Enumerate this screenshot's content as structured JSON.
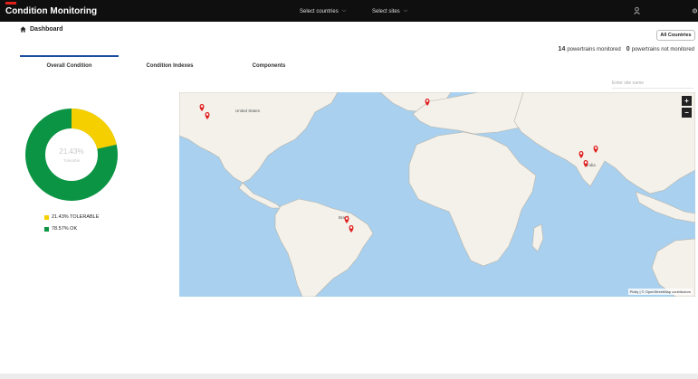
{
  "app": {
    "title": "Condition Monitoring",
    "brand_color": "#e0211b",
    "select_countries": "Select countries",
    "select_sites": "Select sites",
    "user_icon": "user-icon",
    "settings_icon": "gear-icon"
  },
  "breadcrumb": {
    "icon": "home-icon",
    "label": "Dashboard"
  },
  "filter": {
    "all_countries": "All Countries"
  },
  "stats": {
    "monitored_count": "14",
    "monitored_label": "powertrains monitored",
    "not_monitored_count": "0",
    "not_monitored_label": "powertrains not monitored"
  },
  "tabs": [
    {
      "label": "Overall Condition",
      "active": true
    },
    {
      "label": "Condition Indexes",
      "active": false
    },
    {
      "label": "Components",
      "active": false
    }
  ],
  "map": {
    "search_placeholder": "Enter site name",
    "zoom_in": "+",
    "zoom_out": "−",
    "attribution": "Plotly | © OpenStreetMap contributors",
    "labels": [
      "United States",
      "Brazil",
      "India"
    ]
  },
  "donut": {
    "center_value": "21.43%",
    "center_label": "Tolerable",
    "segments": [
      {
        "label": "21.43% TOLERABLE",
        "percent": 21.43,
        "color": "#f5cf00"
      },
      {
        "label": "78.57% OK",
        "percent": 78.57,
        "color": "#0b9444"
      }
    ]
  },
  "colors": {
    "accent": "#1a4fa0",
    "topbar": "#0f0f0f",
    "map_water": "#a9d0ee",
    "map_land": "#f3f1ea",
    "marker": "#e02020"
  }
}
